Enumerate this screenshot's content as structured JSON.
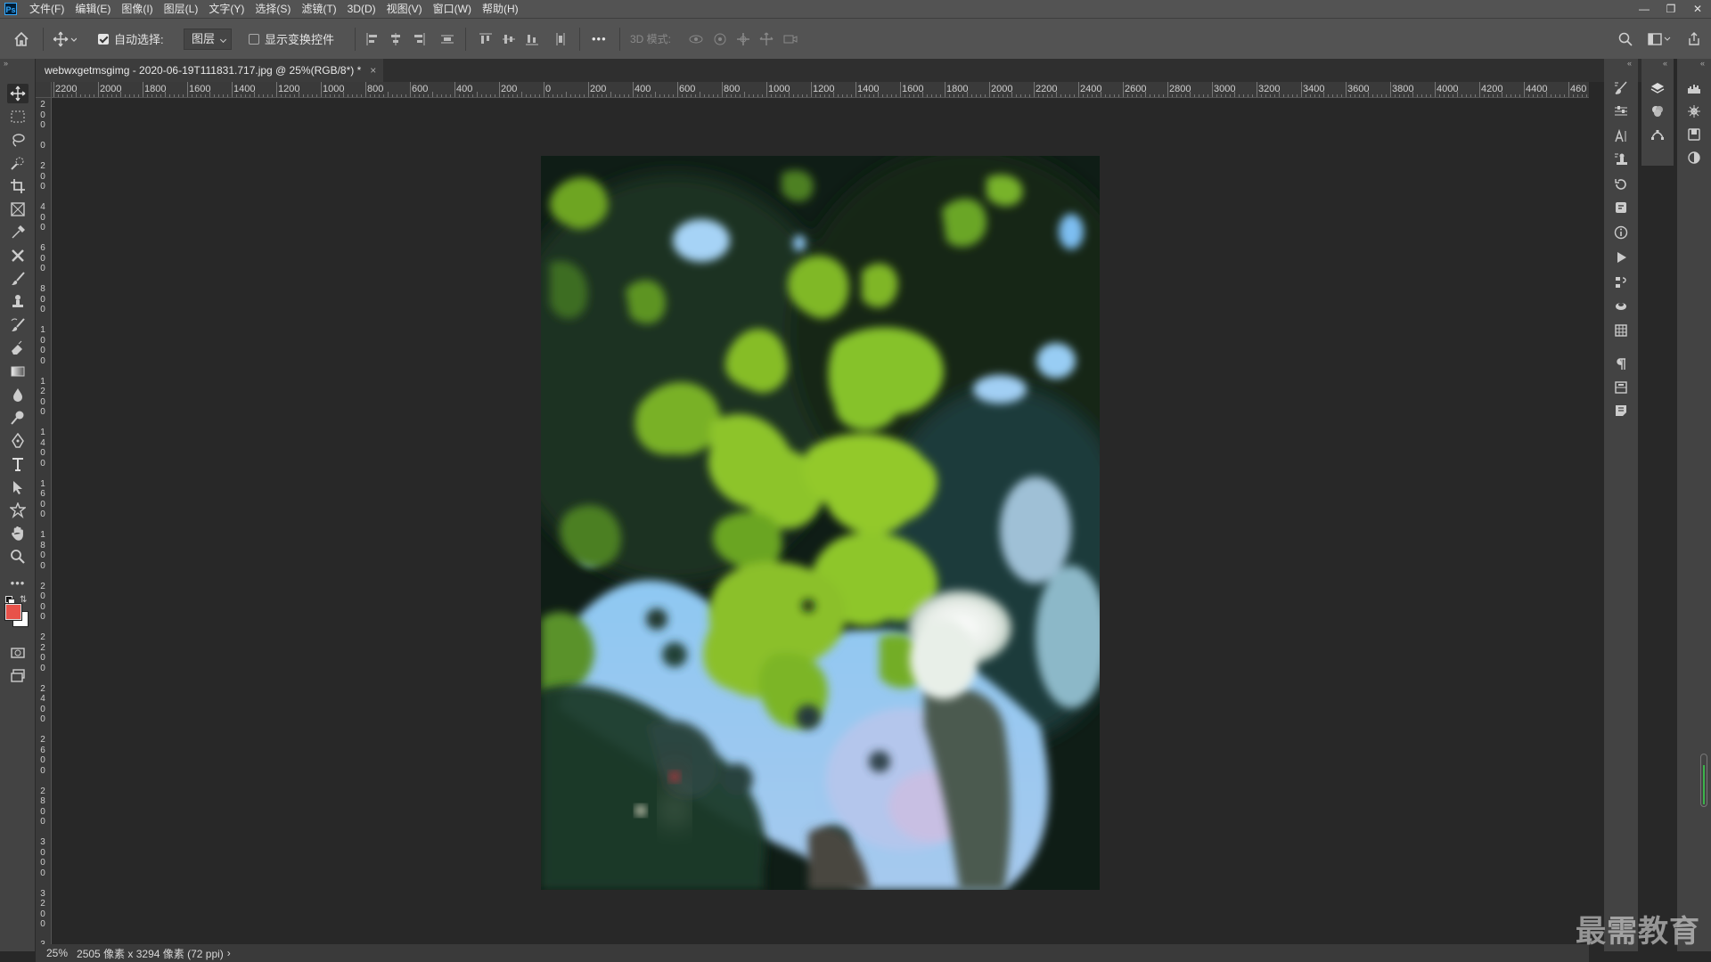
{
  "app": {
    "logo": "Ps"
  },
  "menu": [
    "文件(F)",
    "编辑(E)",
    "图像(I)",
    "图层(L)",
    "文字(Y)",
    "选择(S)",
    "滤镜(T)",
    "3D(D)",
    "视图(V)",
    "窗口(W)",
    "帮助(H)"
  ],
  "options": {
    "auto_select_label": "自动选择:",
    "auto_select_checked": true,
    "auto_select_target": "图层",
    "show_transform_label": "显示变换控件",
    "show_transform_checked": false,
    "more": "•••",
    "mode_3d_label": "3D 模式:"
  },
  "document": {
    "tab_title": "webwxgetmsgimg - 2020-06-19T111831.717.jpg @ 25%(RGB/8*) *",
    "close": "×"
  },
  "ruler_top": [
    "2200",
    "2000",
    "1800",
    "1600",
    "1400",
    "1200",
    "1000",
    "800",
    "600",
    "400",
    "200",
    "0",
    "200",
    "400",
    "600",
    "800",
    "1000",
    "1200",
    "1400",
    "1600",
    "1800",
    "2000",
    "2200",
    "2400",
    "2600",
    "2800",
    "3000",
    "3200",
    "3400",
    "3600",
    "3800",
    "4000",
    "4200",
    "4400",
    "460"
  ],
  "ruler_left": [
    "2",
    "0",
    "0",
    "",
    "0",
    "",
    "2",
    "0",
    "0",
    "",
    "4",
    "0",
    "0",
    "",
    "6",
    "0",
    "0",
    "",
    "8",
    "0",
    "0",
    "",
    "1",
    "0",
    "0",
    "0",
    "",
    "1",
    "2",
    "0",
    "0",
    "",
    "1",
    "4",
    "0",
    "0",
    "",
    "1",
    "6",
    "0",
    "0",
    "",
    "1",
    "8",
    "0",
    "0",
    "",
    "2",
    "0",
    "0",
    "0",
    "",
    "2",
    "2",
    "0",
    "0",
    "",
    "2",
    "4",
    "0",
    "0",
    "",
    "2",
    "6",
    "0",
    "0",
    "",
    "2",
    "8",
    "0",
    "0",
    "",
    "3",
    "0",
    "0",
    "0",
    "",
    "3",
    "2",
    "0",
    "0",
    "",
    "3",
    "4",
    "0"
  ],
  "status": {
    "zoom": "25%",
    "info": "2505 像素 x 3294 像素 (72 ppi)",
    "arrow": "›"
  },
  "colors": {
    "foreground": "#e8524a",
    "background": "#ffffff",
    "accent": "#31a8ff"
  },
  "watermark": "最需教育"
}
